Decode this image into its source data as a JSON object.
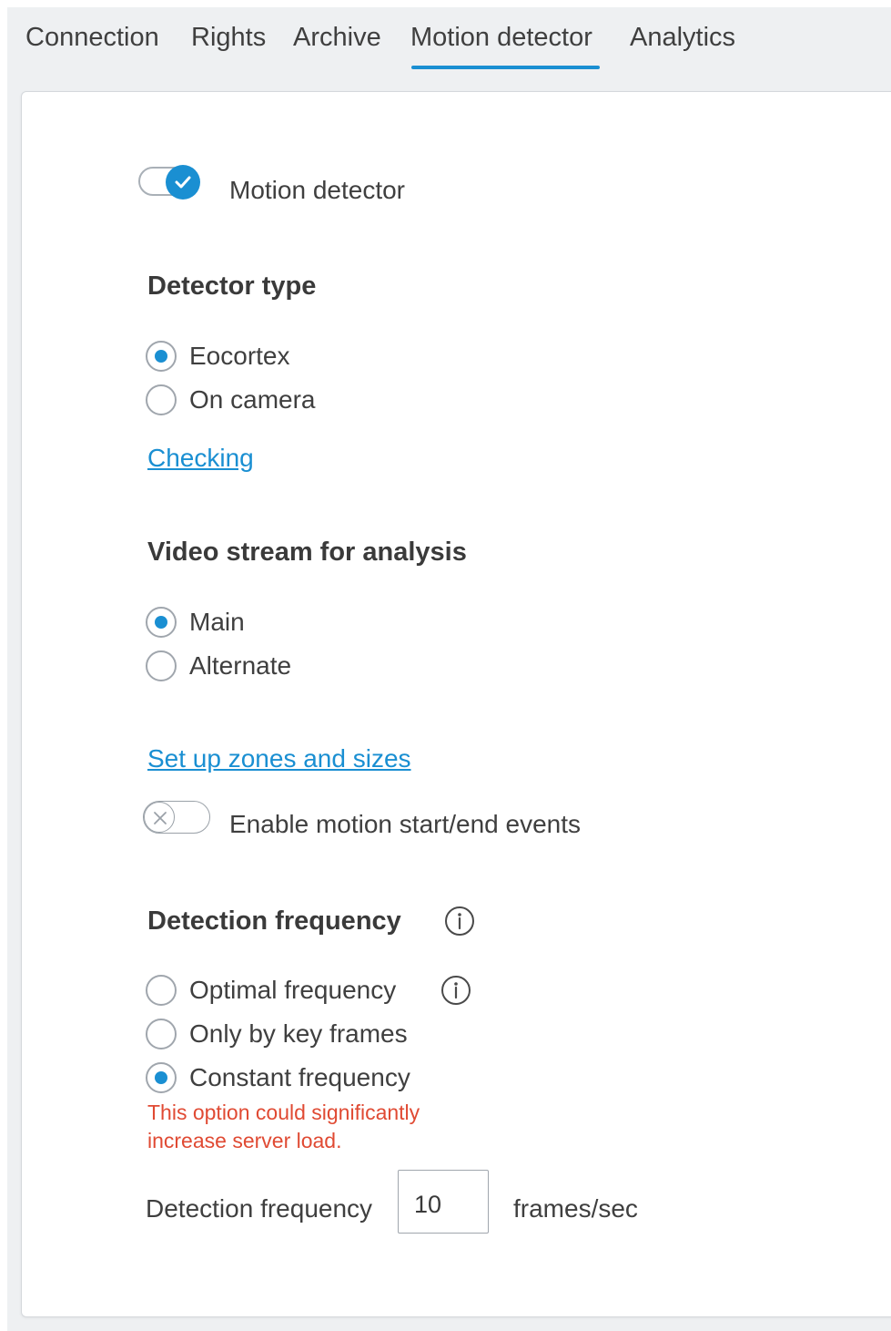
{
  "tabs": [
    {
      "label": "Connection"
    },
    {
      "label": "Rights"
    },
    {
      "label": "Archive"
    },
    {
      "label": "Motion detector",
      "active": true
    },
    {
      "label": "Analytics"
    }
  ],
  "motion_detector": {
    "label": "Motion detector",
    "enabled": true
  },
  "detector_type": {
    "heading": "Detector type",
    "options": [
      {
        "label": "Eocortex",
        "selected": true
      },
      {
        "label": "On camera",
        "selected": false
      }
    ],
    "link": "Checking"
  },
  "video_stream": {
    "heading": "Video stream for analysis",
    "options": [
      {
        "label": "Main",
        "selected": true
      },
      {
        "label": "Alternate",
        "selected": false
      }
    ]
  },
  "zones_link": "Set up zones and sizes",
  "motion_events": {
    "label": "Enable motion start/end events",
    "enabled": false
  },
  "detection_frequency": {
    "heading": "Detection frequency",
    "options": [
      {
        "label": "Optimal frequency",
        "selected": false
      },
      {
        "label": "Only by key frames",
        "selected": false
      },
      {
        "label": "Constant frequency",
        "selected": true
      }
    ],
    "warning_line1": "This option could significantly",
    "warning_line2": "increase server load.",
    "field_label": "Detection frequency",
    "field_value": "10",
    "unit": "frames/sec"
  },
  "colors": {
    "accent": "#1a8fd2",
    "warning": "#e04a33",
    "background": "#eef0f2",
    "panel": "#ffffff"
  }
}
